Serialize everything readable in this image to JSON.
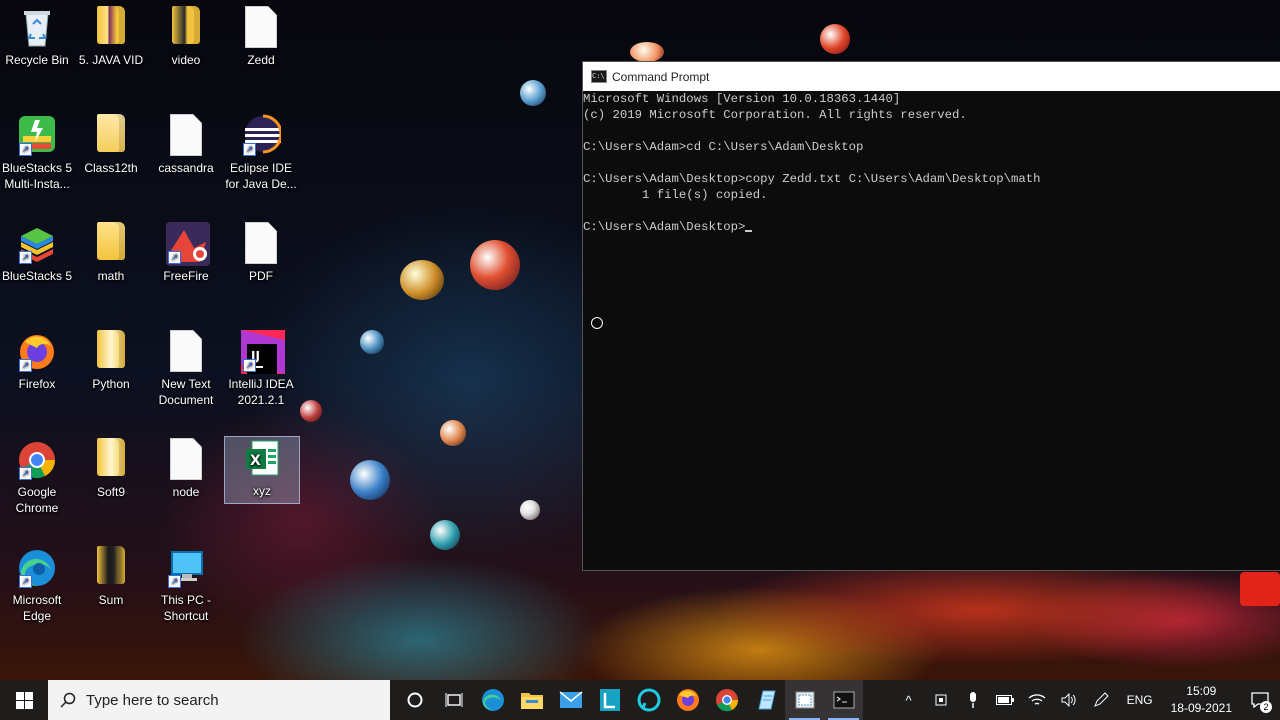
{
  "desktop": {
    "icons": [
      {
        "label": "Recycle Bin"
      },
      {
        "label": "5. JAVA VID"
      },
      {
        "label": "video"
      },
      {
        "label": "Zedd"
      },
      {
        "label": "BlueStacks 5 Multi-Insta..."
      },
      {
        "label": "Class12th"
      },
      {
        "label": "cassandra"
      },
      {
        "label": "Eclipse IDE for Java De..."
      },
      {
        "label": "BlueStacks 5"
      },
      {
        "label": "math"
      },
      {
        "label": "FreeFire"
      },
      {
        "label": "PDF"
      },
      {
        "label": "Firefox"
      },
      {
        "label": "Python"
      },
      {
        "label": "New Text Document"
      },
      {
        "label": "IntelliJ IDEA 2021.2.1"
      },
      {
        "label": "Google Chrome"
      },
      {
        "label": "Soft9"
      },
      {
        "label": "node"
      },
      {
        "label": "xyz"
      },
      {
        "label": "Microsoft Edge"
      },
      {
        "label": "Sum"
      },
      {
        "label": "This PC - Shortcut"
      }
    ]
  },
  "cmd": {
    "title": "Command Prompt",
    "icon_text": "C:\\",
    "lines": [
      "Microsoft Windows [Version 10.0.18363.1440]",
      "(c) 2019 Microsoft Corporation. All rights reserved.",
      "",
      "C:\\Users\\Adam>cd C:\\Users\\Adam\\Desktop",
      "",
      "C:\\Users\\Adam\\Desktop>copy Zedd.txt C:\\Users\\Adam\\Desktop\\math",
      "        1 file(s) copied.",
      "",
      "C:\\Users\\Adam\\Desktop>"
    ]
  },
  "taskbar": {
    "search_placeholder": "Type here to search",
    "apps": [
      "cortana-icon",
      "task-view-icon",
      "edge-icon",
      "file-explorer-icon",
      "mail-icon",
      "libreoffice-icon",
      "alexa-icon",
      "firefox-icon",
      "chrome-icon",
      "notepad-icon",
      "snipping-icon",
      "cmd-icon"
    ],
    "language": "ENG",
    "time": "15:09",
    "date": "18-09-2021",
    "notification_count": "2"
  },
  "colors": {
    "taskbar_bg": "#1f1c1c",
    "console_bg": "#0c0c0c",
    "console_text": "#cccccc",
    "accent": "#8ab4f8"
  }
}
